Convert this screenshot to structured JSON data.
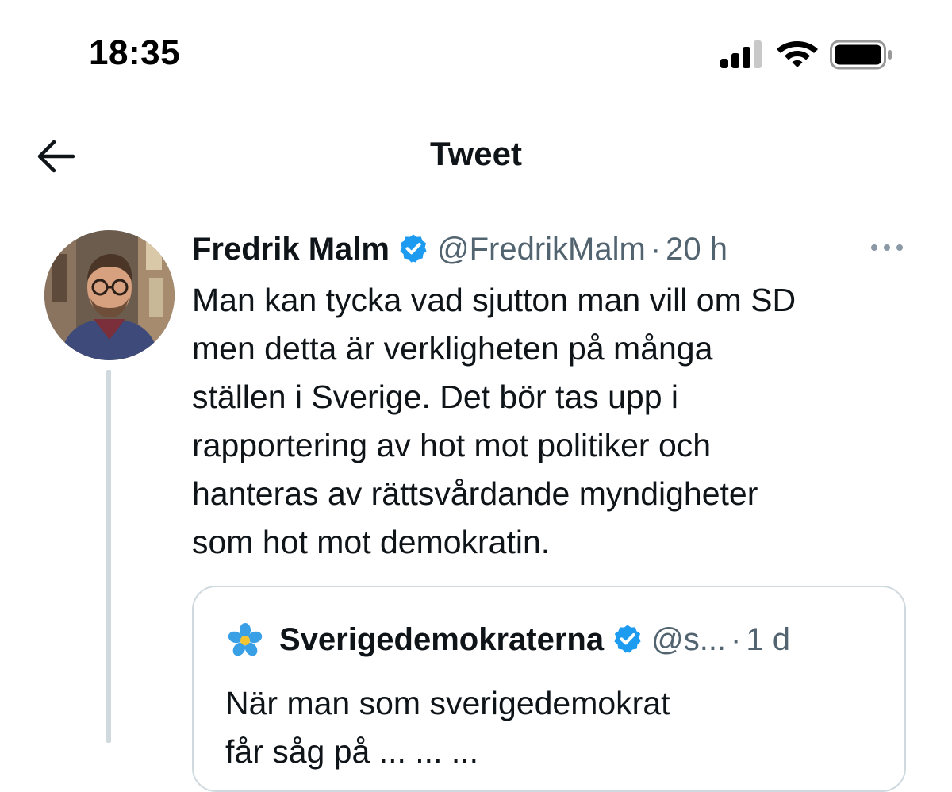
{
  "status_bar": {
    "time": "18:35",
    "signal_icon": "cellular-signal-icon",
    "wifi_icon": "wifi-icon",
    "battery_icon": "battery-icon"
  },
  "header": {
    "back_icon": "back-arrow-icon",
    "title": "Tweet"
  },
  "tweet": {
    "author": {
      "name": "Fredrik Malm",
      "handle": "@FredrikMalm",
      "verified_icon": "verified-badge-icon"
    },
    "separator": "·",
    "time": "20 h",
    "more_icon": "more-options-icon",
    "text": "Man kan tycka vad sjutton man vill om SD\nmen detta är verkligheten på många\nställen i Sverige. Det bör tas upp i\nrapportering av hot mot politiker och\nhanteras av rättsvårdande myndigheter\nsom hot mot demokratin.",
    "quote": {
      "avatar_icon": "blue-flower-icon",
      "name": "Sverigedemokraterna",
      "handle": "@s...",
      "separator": "·",
      "time": "1 d",
      "text_line1": "När man som sverigedemokrat",
      "text_line2": "får såg på ... ... ..."
    }
  },
  "colors": {
    "text_primary": "#0f1419",
    "text_secondary": "#536471",
    "verified_blue": "#1d9bf0",
    "border": "#cfd9de"
  }
}
